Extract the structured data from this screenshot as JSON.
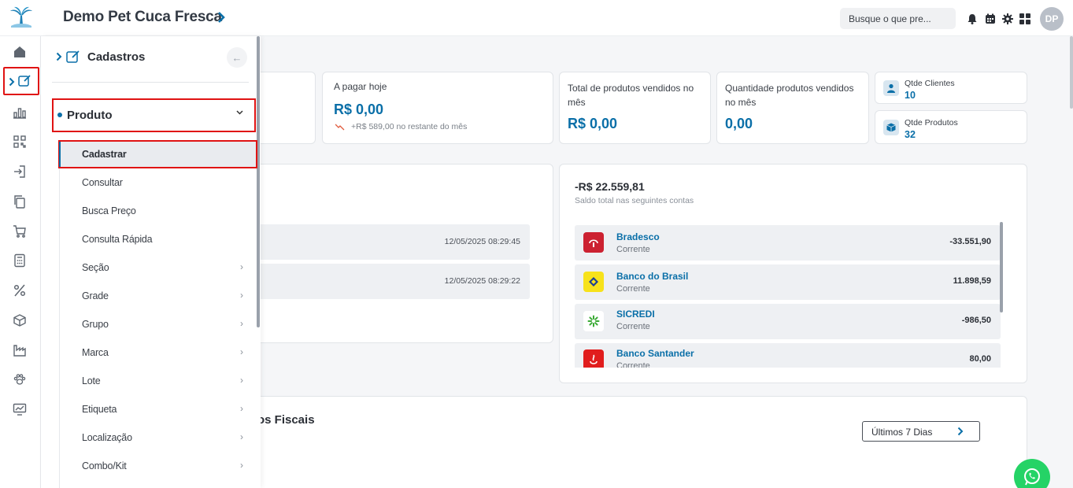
{
  "header": {
    "title": "Demo Pet Cuca Fresca",
    "search_placeholder": "Busque o que pre...",
    "avatar": "DP",
    "icons": [
      "bell-icon",
      "calendar-icon",
      "gear-icon",
      "grid-icon"
    ]
  },
  "rail": {
    "icons": [
      "home-icon",
      "edit-icon",
      "chart-icon",
      "qr-icon",
      "login-icon",
      "copy-icon",
      "cart-icon",
      "calculator-icon",
      "percent-icon",
      "box-icon",
      "factory-icon",
      "paw-icon",
      "monitor-chart-icon"
    ]
  },
  "menu": {
    "header": "Cadastros",
    "group": "Produto",
    "items": [
      {
        "label": "Cadastrar",
        "has_sub": false
      },
      {
        "label": "Consultar",
        "has_sub": false
      },
      {
        "label": "Busca Preço",
        "has_sub": false
      },
      {
        "label": "Consulta Rápida",
        "has_sub": false
      },
      {
        "label": "Seção",
        "has_sub": true
      },
      {
        "label": "Grade",
        "has_sub": true
      },
      {
        "label": "Grupo",
        "has_sub": true
      },
      {
        "label": "Marca",
        "has_sub": true
      },
      {
        "label": "Lote",
        "has_sub": true
      },
      {
        "label": "Etiqueta",
        "has_sub": true
      },
      {
        "label": "Localização",
        "has_sub": true
      },
      {
        "label": "Combo/Kit",
        "has_sub": true
      }
    ]
  },
  "dashboard": {
    "pagar": {
      "label": "A pagar hoje",
      "value": "R$ 0,00",
      "note": "+R$ 589,00 no restante do mês"
    },
    "vendidos": {
      "label": "Total de produtos vendidos no mês",
      "value": "R$ 0,00"
    },
    "qtd": {
      "label": "Quantidade produtos vendidos no mês",
      "value": "0,00"
    },
    "clientes": {
      "label": "Qtde Clientes",
      "value": "10"
    },
    "produtos": {
      "label": "Qtde Produtos",
      "value": "32"
    },
    "rows": [
      {
        "date": "12/05/2025 08:29:45"
      },
      {
        "date": "12/05/2025 08:29:22"
      }
    ],
    "saldo": {
      "value": "-R$ 22.559,81",
      "caption": "Saldo total nas seguintes contas"
    },
    "accounts": [
      {
        "name": "Bradesco",
        "type": "Corrente",
        "value": "-33.551,90",
        "color": "#cc2131"
      },
      {
        "name": "Banco do Brasil",
        "type": "Corrente",
        "value": "11.898,59",
        "color": "#f7e21b"
      },
      {
        "name": "SICREDI",
        "type": "Corrente",
        "value": "-986,50",
        "color": "#ffffff"
      },
      {
        "name": "Banco Santander",
        "type": "Corrente",
        "value": "80,00",
        "color": "#e11d1d"
      }
    ],
    "fiscais_title": "os Fiscais",
    "period_button": "Últimos 7 Dias"
  }
}
